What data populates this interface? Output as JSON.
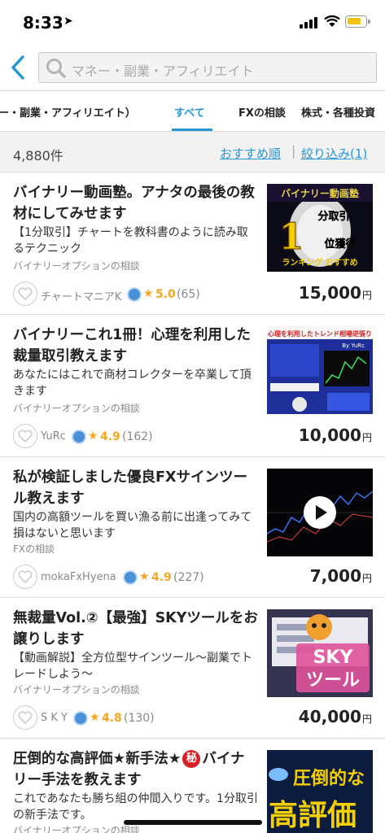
{
  "status": {
    "time": "8:33",
    "location_icon": "location-arrow-icon"
  },
  "search": {
    "placeholder": "マネー・副業・アフィリエイト"
  },
  "tabs": [
    {
      "label": "ー・副業・アフィリエイト）",
      "active": false
    },
    {
      "label": "すべて",
      "active": true
    },
    {
      "label": "FXの相談",
      "active": false
    },
    {
      "label": "株式・各種投資",
      "active": false
    }
  ],
  "results": {
    "count": "4,880件",
    "sort_label": "おすすめ順",
    "separator": "|",
    "filter_label": "絞り込み(1)"
  },
  "listings": [
    {
      "title": "バイナリー動画塾。アナタの最後の教材にしてみせます",
      "description": "【1分取引】チャートを教科書のように読み取るテクニック",
      "category": "バイナリーオプションの相談",
      "seller": "チャートマニアK",
      "rating": "5.0",
      "reviews": "(65)",
      "price": "15,000",
      "yen": "円",
      "thumb_text": [
        "バイナリー動画塾",
        "1",
        "分取引",
        "位獲得",
        "ランキング おすすめ"
      ]
    },
    {
      "title": "バイナリーこれ1冊！心理を利用した裁量取引教えます",
      "description": "あなたにはこれで商材コレクターを卒業して頂きます",
      "category": "バイナリーオプションの相談",
      "seller": "YuRc",
      "rating": "4.9",
      "reviews": "(162)",
      "price": "10,000",
      "yen": "円",
      "thumb_text": [
        "心理を利用したトレンド相場逆張り",
        "By YuRc"
      ]
    },
    {
      "title": "私が検証しました優良FXサインツール教えます",
      "description": "国内の高額ツールを買い漁る前に出逢ってみて損はないと思います",
      "category": "FXの相談",
      "seller": "mokaFxHyena",
      "rating": "4.9",
      "reviews": "(227)",
      "price": "7,000",
      "yen": "円",
      "thumb_text": []
    },
    {
      "title": "無裁量Vol.②【最強】SKYツールをお譲りします",
      "description": "【動画解説】全方位型サインツール〜副業でトレードしよう〜",
      "category": "バイナリーオプションの相談",
      "seller": "S K Y",
      "rating": "4.8",
      "reviews": "(130)",
      "price": "40,000",
      "yen": "円",
      "thumb_text": [
        "SKY",
        "ツール"
      ]
    },
    {
      "title_a": "圧倒的な高評価★新手法★",
      "title_mark": "秘",
      "title_b": "バイナリー手法を教えます",
      "description": "これであなたも勝ち組の仲間入りです。1分取引の新手法です。",
      "category": "バイナリーオプションの相談",
      "thumb_text": [
        "圧倒的な",
        "高評価"
      ]
    }
  ],
  "colors": {
    "accent": "#2597d8",
    "rating": "#f5a623"
  }
}
